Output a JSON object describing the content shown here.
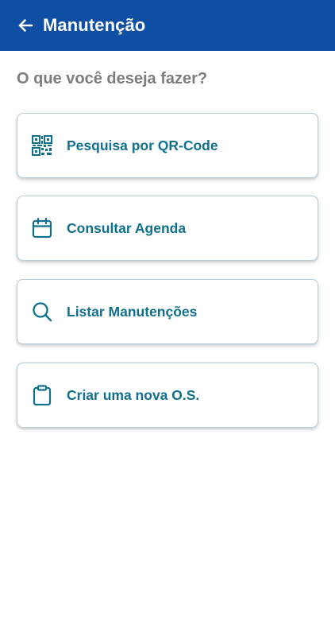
{
  "header": {
    "back_icon": "arrow-left-icon",
    "title": "Manutenção",
    "background_color": "#0e4fa3"
  },
  "prompt": "O que você deseja fazer?",
  "actions": [
    {
      "label": "Pesquisa por QR-Code",
      "icon": "qr-code-icon"
    },
    {
      "label": "Consultar Agenda",
      "icon": "calendar-icon"
    },
    {
      "label": "Listar Manutenções",
      "icon": "search-icon"
    },
    {
      "label": "Criar uma nova O.S.",
      "icon": "clipboard-icon"
    }
  ],
  "colors": {
    "accent": "#10718f",
    "prompt_text": "#7d7d7d"
  }
}
